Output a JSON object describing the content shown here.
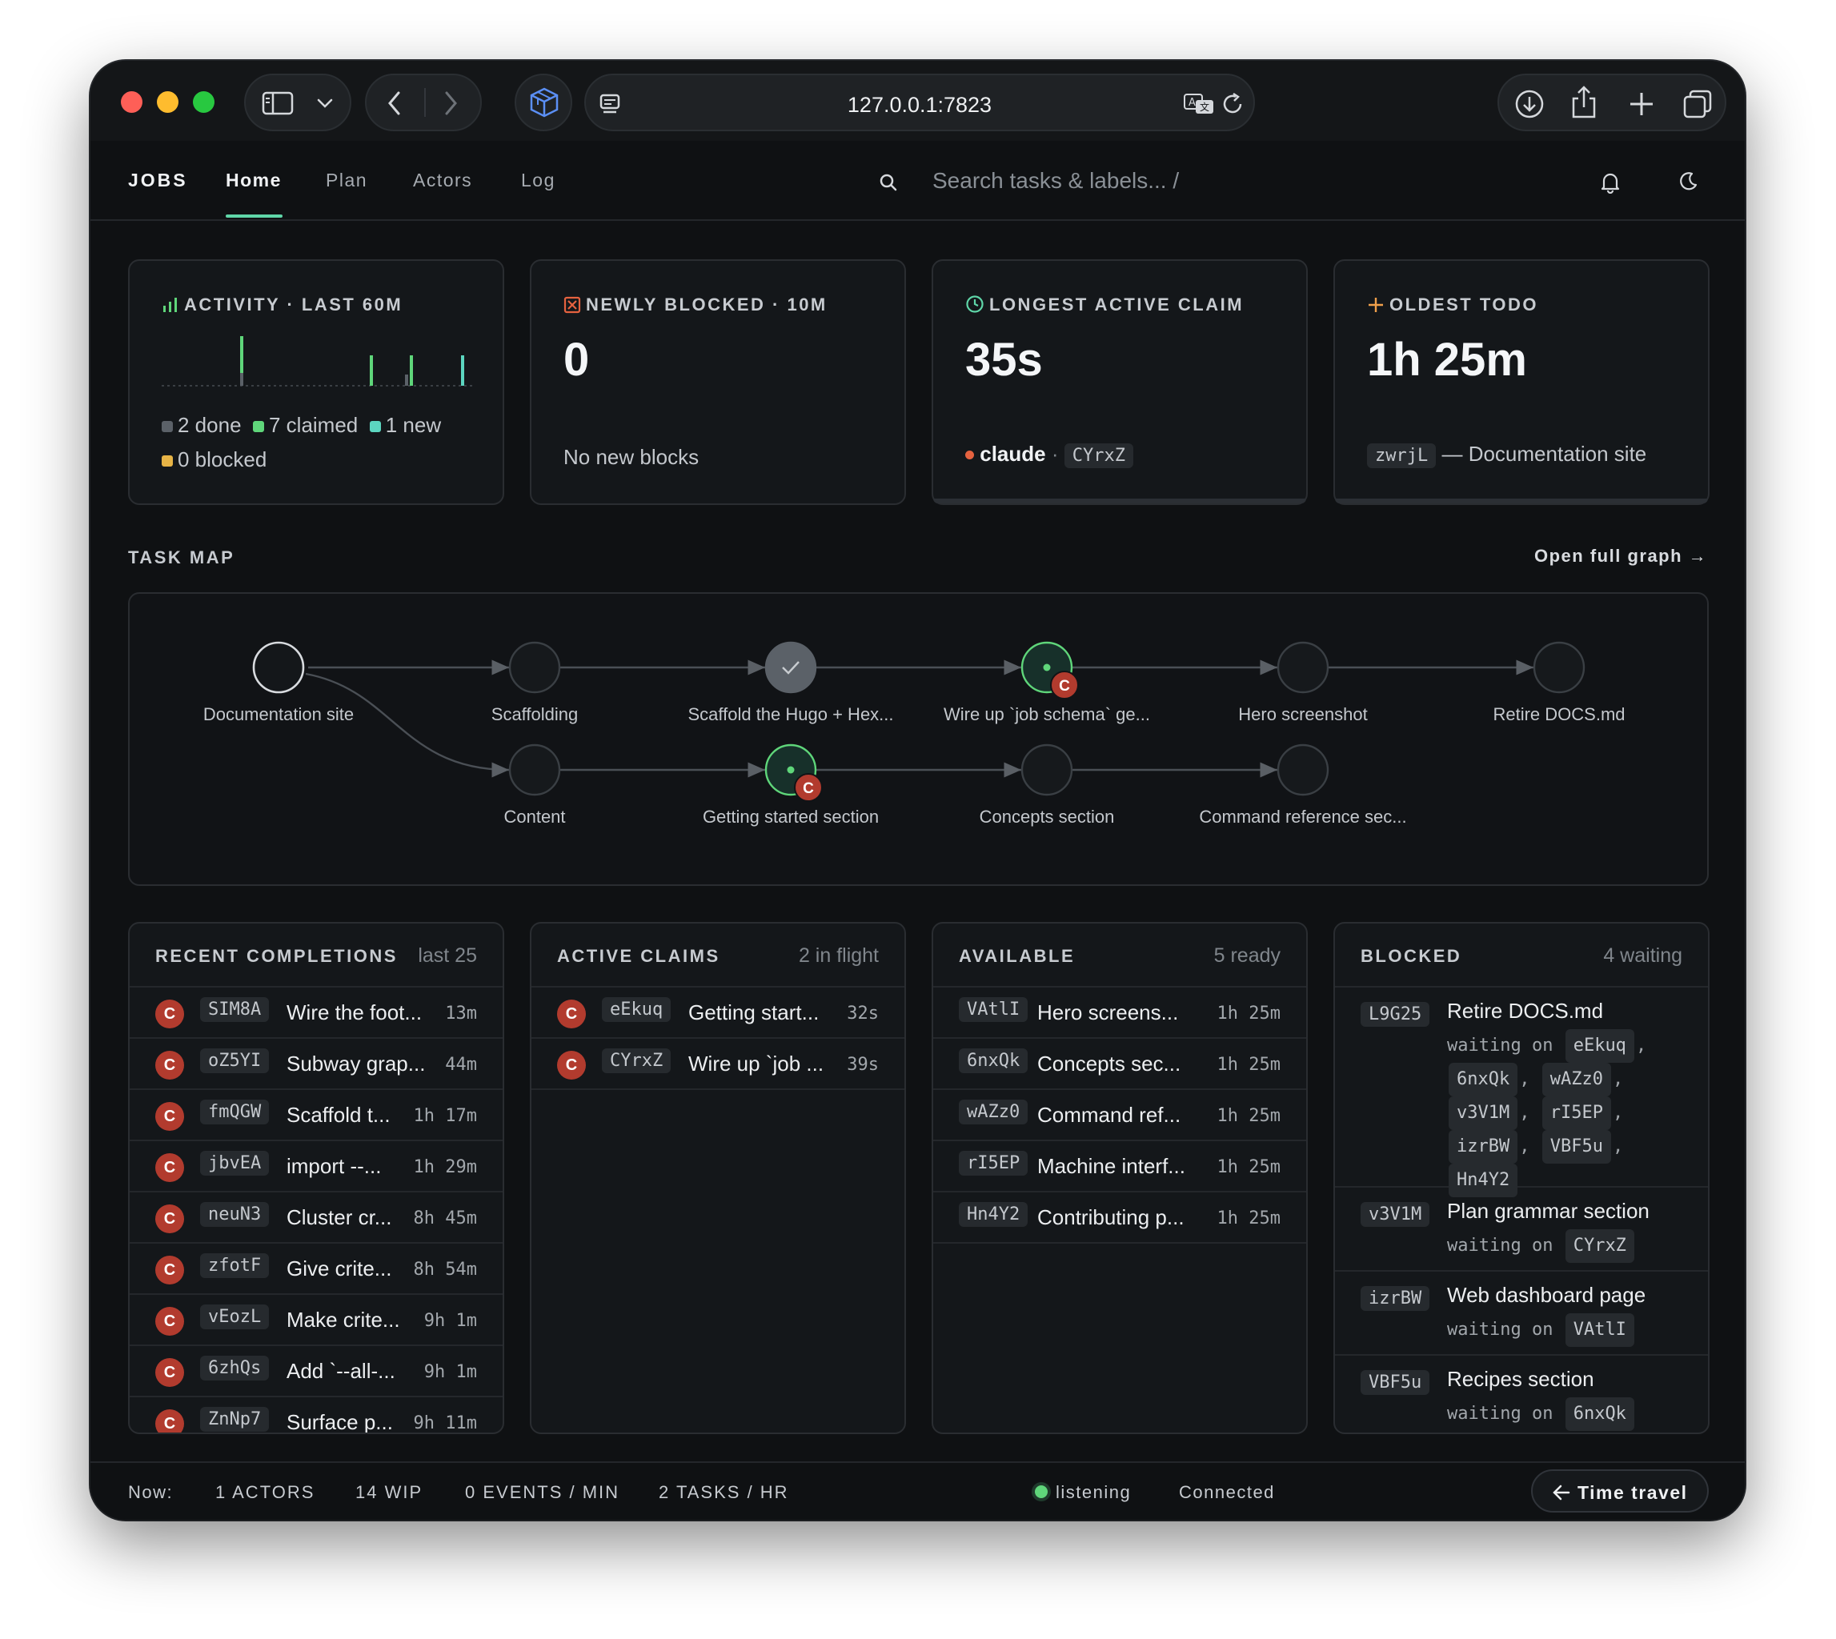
{
  "browser": {
    "url": "127.0.0.1:7823"
  },
  "nav": {
    "brand": "JOBS",
    "tabs": [
      "Home",
      "Plan",
      "Actors",
      "Log"
    ],
    "search_placeholder": "Search tasks & labels...  /"
  },
  "activity": {
    "title": "ACTIVITY · LAST 60M",
    "legend": [
      {
        "label": "2 done",
        "color": "#5b6168"
      },
      {
        "label": "7 claimed",
        "color": "#5fd67a"
      },
      {
        "label": "1 new",
        "color": "#5cd6c0"
      },
      {
        "label": "0 blocked",
        "color": "#e7b446"
      }
    ]
  },
  "newly_blocked": {
    "title": "NEWLY BLOCKED · 10M",
    "value": "0",
    "note": "No new blocks"
  },
  "longest_claim": {
    "title": "LONGEST ACTIVE CLAIM",
    "value": "35s",
    "actor": "claude",
    "sep": "·",
    "task_id": "CYrxZ"
  },
  "oldest_todo": {
    "title": "OLDEST TODO",
    "value": "1h 25m",
    "task_id": "zwrjL",
    "task_name": "— Documentation site"
  },
  "task_map": {
    "title": "TASK MAP",
    "link": "Open full graph →",
    "nodes": [
      {
        "label": "Documentation site"
      },
      {
        "label": "Scaffolding"
      },
      {
        "label": "Scaffold the Hugo + Hex..."
      },
      {
        "label": "Wire up `job schema` ge..."
      },
      {
        "label": "Hero screenshot"
      },
      {
        "label": "Retire DOCS.md"
      },
      {
        "label": "Content"
      },
      {
        "label": "Getting started section"
      },
      {
        "label": "Concepts section"
      },
      {
        "label": "Command reference sec..."
      }
    ],
    "badge": "C"
  },
  "recent": {
    "title": "RECENT COMPLETIONS",
    "count": "last 25",
    "rows": [
      {
        "avatar": "C",
        "id": "SIM8A",
        "title": "Wire the foot...",
        "age": "13m"
      },
      {
        "avatar": "C",
        "id": "oZ5YI",
        "title": "Subway grap...",
        "age": "44m"
      },
      {
        "avatar": "C",
        "id": "fmQGW",
        "title": "Scaffold t...",
        "age": "1h 17m"
      },
      {
        "avatar": "C",
        "id": "jbvEA",
        "title": "import --...",
        "age": "1h 29m"
      },
      {
        "avatar": "C",
        "id": "neuN3",
        "title": "Cluster cr...",
        "age": "8h 45m"
      },
      {
        "avatar": "C",
        "id": "zfotF",
        "title": "Give crite...",
        "age": "8h 54m"
      },
      {
        "avatar": "C",
        "id": "vEozL",
        "title": "Make crite...",
        "age": "9h 1m"
      },
      {
        "avatar": "C",
        "id": "6zhQs",
        "title": "Add `--all-...",
        "age": "9h 1m"
      },
      {
        "avatar": "C",
        "id": "ZnNp7",
        "title": "Surface p...",
        "age": "9h 11m"
      }
    ]
  },
  "active": {
    "title": "ACTIVE CLAIMS",
    "count": "2 in flight",
    "rows": [
      {
        "avatar": "C",
        "id": "eEkuq",
        "title": "Getting start...",
        "age": "32s"
      },
      {
        "avatar": "C",
        "id": "CYrxZ",
        "title": "Wire up `job ...",
        "age": "39s"
      }
    ]
  },
  "available": {
    "title": "AVAILABLE",
    "count": "5 ready",
    "rows": [
      {
        "id": "VAtlI",
        "title": "Hero screens...",
        "age": "1h 25m"
      },
      {
        "id": "6nxQk",
        "title": "Concepts sec...",
        "age": "1h 25m"
      },
      {
        "id": "wAZz0",
        "title": "Command ref...",
        "age": "1h 25m"
      },
      {
        "id": "rI5EP",
        "title": "Machine interf...",
        "age": "1h 25m"
      },
      {
        "id": "Hn4Y2",
        "title": "Contributing p...",
        "age": "1h 25m"
      }
    ]
  },
  "blocked": {
    "title": "BLOCKED",
    "count": "4 waiting",
    "waiting_label": "waiting on",
    "rows": [
      {
        "id": "L9G25",
        "title": "Retire DOCS.md",
        "deps": [
          "eEkuq",
          "6nxQk",
          "wAZz0",
          "v3V1M",
          "rI5EP",
          "izrBW",
          "VBF5u",
          "Hn4Y2"
        ]
      },
      {
        "id": "v3V1M",
        "title": "Plan grammar section",
        "deps": [
          "CYrxZ"
        ]
      },
      {
        "id": "izrBW",
        "title": "Web dashboard page",
        "deps": [
          "VAtlI"
        ]
      },
      {
        "id": "VBF5u",
        "title": "Recipes section",
        "deps": [
          "6nxQk"
        ]
      }
    ]
  },
  "footer": {
    "now": "Now:",
    "actors": "1 ACTORS",
    "wip": "14 WIP",
    "events": "0 EVENTS / MIN",
    "tasks": "2 TASKS / HR",
    "listening": "listening",
    "connected": "Connected",
    "time_travel": "Time travel"
  },
  "colors": {
    "accent": "#5fd6a8",
    "actor_badge": "#b23b2e",
    "claimed": "#5fd67a"
  }
}
